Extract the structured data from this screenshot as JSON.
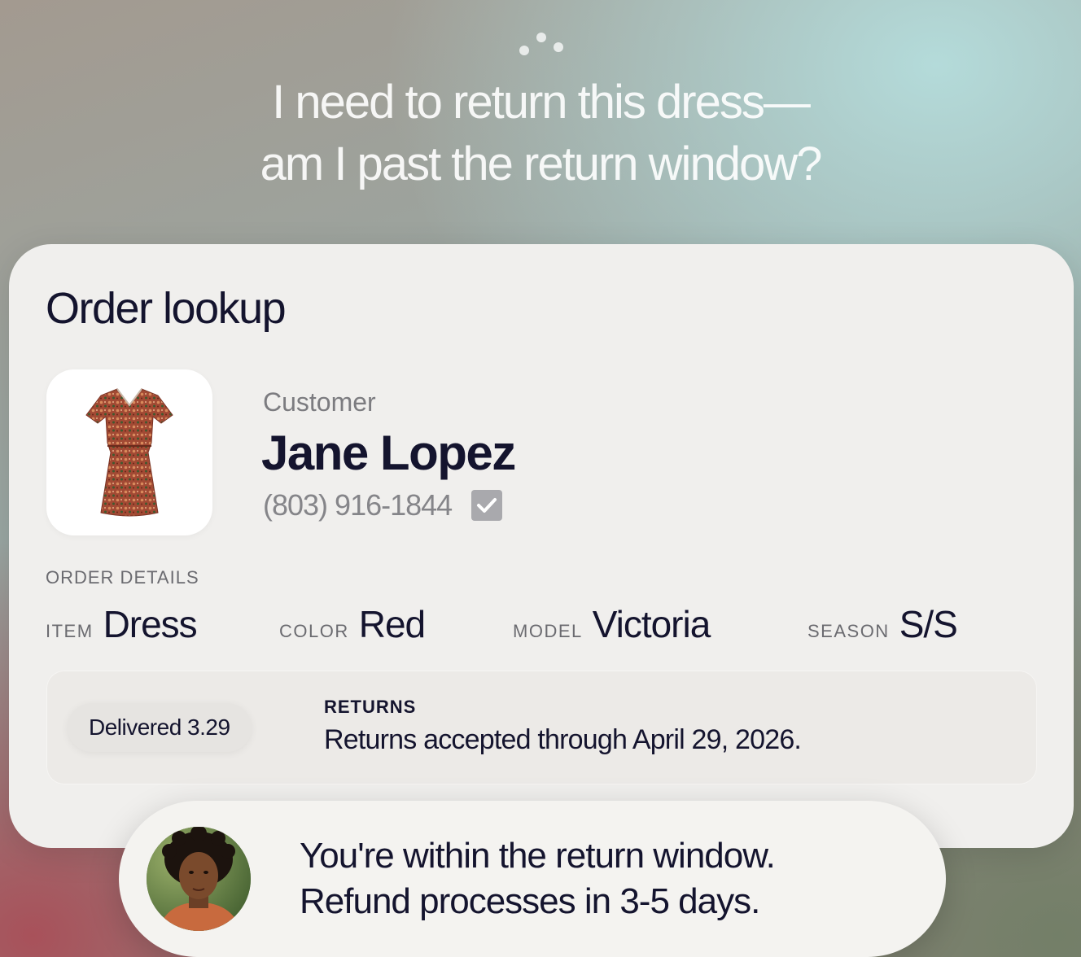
{
  "prompt": {
    "line1": "I need to return this dress—",
    "line2": "am I past the return window?"
  },
  "card": {
    "title": "Order lookup",
    "product_icon": "dress-photo",
    "customer": {
      "label": "Customer",
      "name": "Jane Lopez",
      "phone": "(803) 916-1844",
      "verified_icon": "check-icon"
    },
    "order_details": {
      "label": "ORDER DETAILS",
      "fields": [
        {
          "key": "ITEM",
          "value": "Dress"
        },
        {
          "key": "COLOR",
          "value": "Red"
        },
        {
          "key": "MODEL",
          "value": "Victoria"
        },
        {
          "key": "SEASON",
          "value": "S/S"
        }
      ]
    },
    "returns": {
      "status_pill": "Delivered 3.29",
      "label": "RETURNS",
      "text": "Returns accepted through April 29, 2026."
    }
  },
  "response": {
    "avatar_icon": "agent-avatar",
    "line1": "You're within the return window.",
    "line2": "Refund processes in 3-5 days."
  },
  "colors": {
    "ink": "#14142e",
    "card": "#f0efed",
    "muted": "#7c7c80"
  }
}
